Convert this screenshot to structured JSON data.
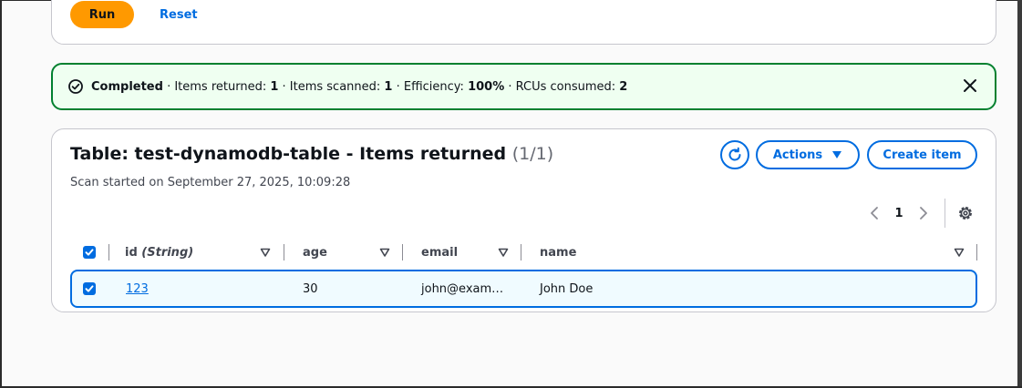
{
  "top_card": {
    "run_label": "Run",
    "reset_label": "Reset"
  },
  "banner": {
    "status": "Completed",
    "items_returned_label": " · Items returned: ",
    "items_returned": "1",
    "items_scanned_label": " · Items scanned: ",
    "items_scanned": "1",
    "efficiency_label": " · Efficiency: ",
    "efficiency": "100%",
    "rcus_label": " · RCUs consumed: ",
    "rcus": "2",
    "status_color": "#00802f"
  },
  "table": {
    "title": "Table: test-dynamodb-table - Items returned",
    "count": "(1/1)",
    "subtitle": "Scan started on September 27, 2025, 10:09:28",
    "actions_label": "Actions",
    "create_label": "Create item",
    "page": "1",
    "columns": {
      "id_name": "id",
      "id_type": "(String)",
      "age": "age",
      "email": "email",
      "name": "name"
    },
    "rows": [
      {
        "id": "123",
        "age": "30",
        "email": "john@exam…",
        "name": "John Doe",
        "selected": true
      }
    ]
  },
  "colors": {
    "accent": "#006ce0",
    "primary": "#ff9900"
  }
}
